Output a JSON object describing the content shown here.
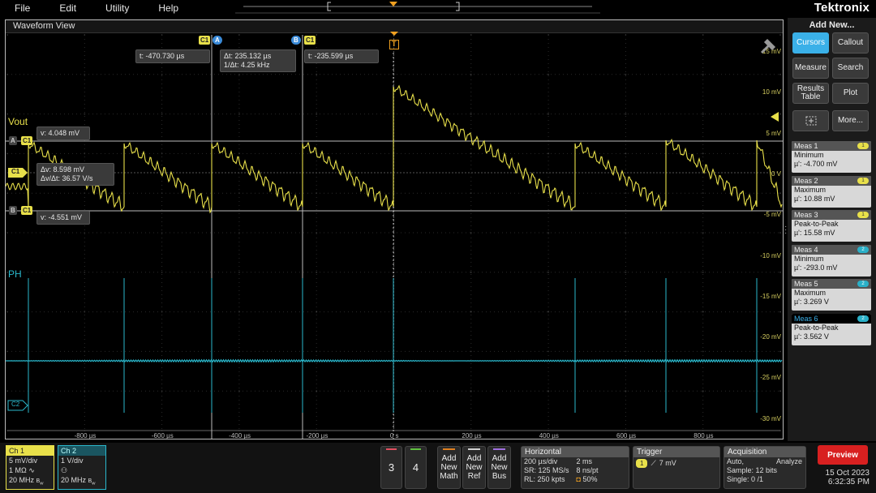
{
  "menu": [
    "File",
    "Edit",
    "Utility",
    "Help"
  ],
  "brand": "Tektronix",
  "waveform_view": {
    "title": "Waveform View",
    "y_labels": [
      "15 mV",
      "10 mV",
      "5 mV",
      "0 V",
      "-5 mV",
      "-10 mV",
      "-15 mV",
      "-20 mV",
      "-25 mV",
      "-30 mV"
    ],
    "x_labels": [
      "-800 µs",
      "-600 µs",
      "-400 µs",
      "-200 µs",
      "0 s",
      "200 µs",
      "400 µs",
      "600 µs",
      "800 µs"
    ],
    "channels": {
      "ch1_label": "Vout",
      "ch2_label": "PH",
      "ch1_color": "#e8e04a",
      "ch2_color": "#2ab8cc"
    },
    "cursor_tags": {
      "c1": "C1",
      "a": "A",
      "b": "B",
      "c2": "C2",
      "t": "T"
    },
    "readouts": {
      "t_a": "t: -470.730 µs",
      "dt": "Δt: 235.132 µs",
      "inv_dt": "1/Δt: 4.25 kHz",
      "t_b": "t: -235.599 µs",
      "v_a": "v: 4.048 mV",
      "dv": "Δv: 8.598 mV",
      "dvdt": "Δv/Δt: 36.57 V/s",
      "v_b": "v: -4.551 mV"
    }
  },
  "right_panel": {
    "title": "Add New...",
    "buttons": {
      "cursors": "Cursors",
      "callout": "Callout",
      "measure": "Measure",
      "search": "Search",
      "results": "Results Table",
      "plot": "Plot",
      "more": "More..."
    },
    "measurements": [
      {
        "name": "Meas 1",
        "badge": "1",
        "type": "Minimum",
        "value": "µ': -4.700 mV"
      },
      {
        "name": "Meas 2",
        "badge": "1",
        "type": "Maximum",
        "value": "µ': 10.88 mV"
      },
      {
        "name": "Meas 3",
        "badge": "1",
        "type": "Peak-to-Peak",
        "value": "µ': 15.58 mV"
      },
      {
        "name": "Meas 4",
        "badge": "2",
        "type": "Minimum",
        "value": "µ': -293.0 mV"
      },
      {
        "name": "Meas 5",
        "badge": "2",
        "type": "Maximum",
        "value": "µ': 3.269 V"
      },
      {
        "name": "Meas 6",
        "badge": "2",
        "type": "Peak-to-Peak",
        "value": "µ': 3.562 V"
      }
    ]
  },
  "bottom": {
    "ch1": {
      "title": "Ch 1",
      "scale": "5 mV/div",
      "imp": "1 MΩ",
      "bw": "20 MHz"
    },
    "ch2": {
      "title": "Ch 2",
      "scale": "1 V/div",
      "bw": "20 MHz"
    },
    "buttons": {
      "b3": "3",
      "b4": "4",
      "math": "Add New Math",
      "ref": "Add New Ref",
      "bus": "Add New Bus"
    },
    "horizontal": {
      "title": "Horizontal",
      "scale": "200 µs/div",
      "record": "2 ms",
      "sr": "SR: 125 MS/s",
      "pt": "8 ns/pt",
      "rl": "RL: 250 kpts",
      "pos": "50%"
    },
    "trigger": {
      "title": "Trigger",
      "source": "1",
      "level": "7 mV"
    },
    "acquisition": {
      "title": "Acquisition",
      "mode": "Auto,",
      "analyze": "Analyze",
      "sample": "Sample: 12 bits",
      "single": "Single: 0 /1"
    },
    "preview": "Preview",
    "date": "15 Oct 2023",
    "time": "6:32:35 PM"
  }
}
